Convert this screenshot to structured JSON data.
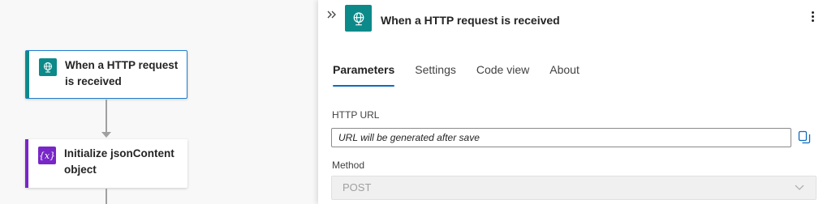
{
  "canvas": {
    "nodes": [
      {
        "label": "When a HTTP request is received",
        "icon": "http-globe-icon",
        "color": "#0c8a8a",
        "selected": true
      },
      {
        "label": "Initialize jsonContent object",
        "icon": "variable-icon",
        "icon_glyph": "{x}",
        "color": "#7826c8",
        "selected": false
      }
    ]
  },
  "panel": {
    "title": "When a HTTP request is received",
    "icon": "http-globe-icon",
    "tabs": [
      {
        "label": "Parameters",
        "active": true
      },
      {
        "label": "Settings",
        "active": false
      },
      {
        "label": "Code view",
        "active": false
      },
      {
        "label": "About",
        "active": false
      }
    ],
    "http_url": {
      "label": "HTTP URL",
      "placeholder": "URL will be generated after save"
    },
    "method": {
      "label": "Method",
      "value": "POST"
    }
  },
  "colors": {
    "accent_blue": "#0f6cbd",
    "trigger_teal": "#0c8a8a",
    "variable_purple": "#7826c8"
  }
}
